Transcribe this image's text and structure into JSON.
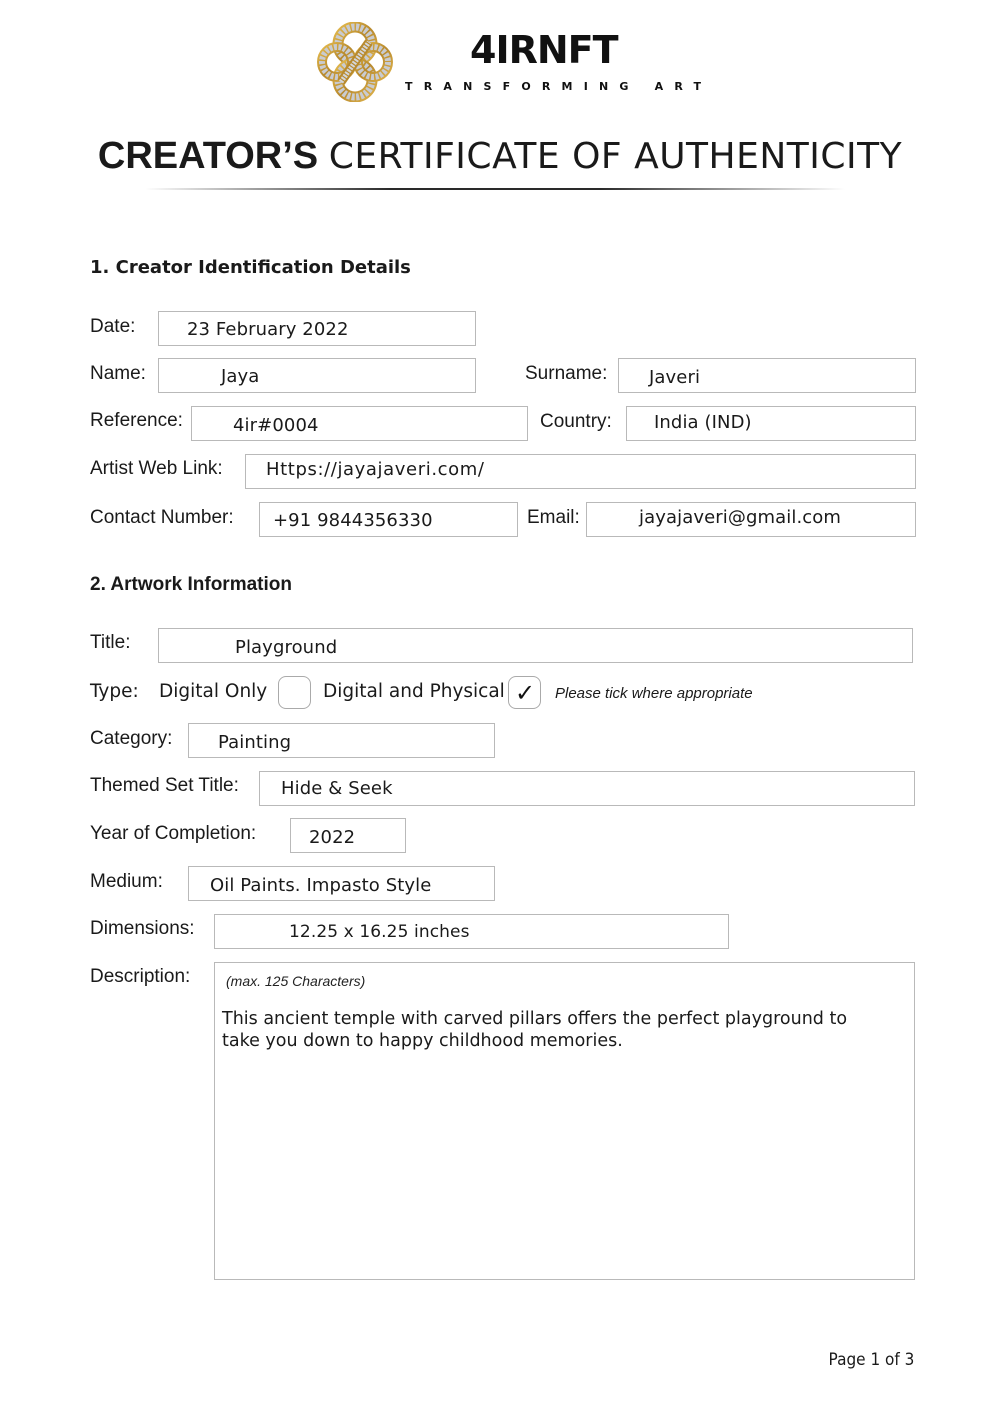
{
  "header": {
    "logo_icon": "infinity-knot-logo-icon",
    "brand_name": "4IRNFT",
    "tagline": "TRANSFORMING ART",
    "title_bold": "CREATOR’S",
    "title_rest": "CERTIFICATE OF AUTHENTICITY"
  },
  "section1": {
    "heading": "1. Creator Identification Details",
    "fields": {
      "date": {
        "label": "Date:",
        "value": "23 February 2022"
      },
      "name": {
        "label": "Name:",
        "value": "Jaya"
      },
      "surname": {
        "label": "Surname:",
        "value": "Javeri"
      },
      "reference": {
        "label": "Reference:",
        "value": "4ir#0004"
      },
      "country": {
        "label": "Country:",
        "value": "India (IND)"
      },
      "web_link": {
        "label": "Artist Web Link:",
        "value": "Https://jayajaveri.com/"
      },
      "contact": {
        "label": "Contact Number:",
        "value": "+91 9844356330"
      },
      "email": {
        "label": "Email:",
        "value": "jayajaveri@gmail.com"
      }
    }
  },
  "section2": {
    "heading": "2. Artwork Information",
    "fields": {
      "title": {
        "label": "Title:",
        "value": "Playground"
      },
      "type": {
        "label": "Type:",
        "options": [
          {
            "label": "Digital Only",
            "checked": false
          },
          {
            "label": "Digital and Physical",
            "checked": true
          }
        ],
        "tick_glyph": "✓",
        "hint": "Please tick where appropriate"
      },
      "category": {
        "label": "Category:",
        "value": "Painting"
      },
      "themed_set": {
        "label": "Themed Set Title:",
        "value": "Hide & Seek"
      },
      "year": {
        "label": "Year of Completion:",
        "value": "2022"
      },
      "medium": {
        "label": "Medium:",
        "value": "Oil Paints. Impasto Style"
      },
      "dimensions": {
        "label": "Dimensions:",
        "value": "12.25 x 16.25 inches"
      },
      "description": {
        "label": "Description:",
        "hint": "(max. 125 Characters)",
        "line1": "This ancient temple with carved pillars offers the perfect playground to",
        "line2": "take you down to happy childhood memories."
      }
    }
  },
  "footer": {
    "page_label": "Page 1 of 3"
  }
}
